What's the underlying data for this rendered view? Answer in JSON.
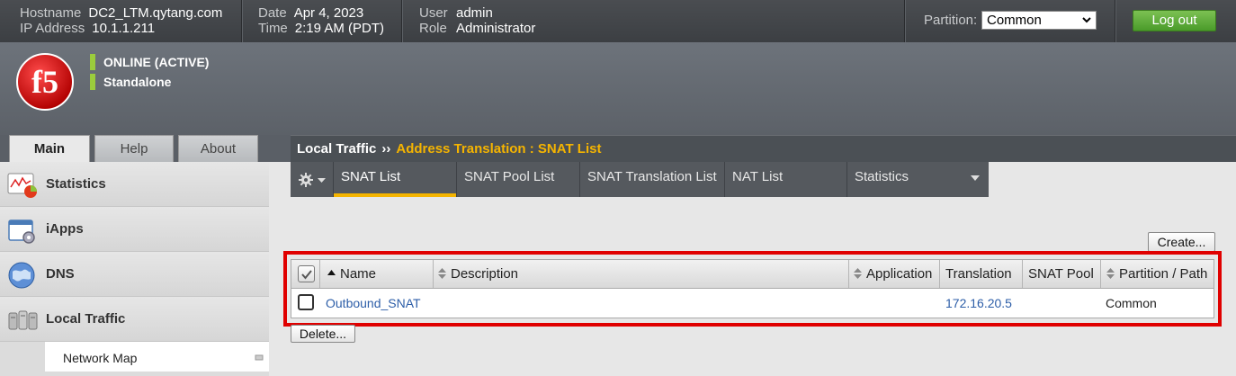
{
  "topbar": {
    "hostname_label": "Hostname",
    "hostname_value": "DC2_LTM.qytang.com",
    "ip_label": "IP Address",
    "ip_value": "10.1.1.211",
    "date_label": "Date",
    "date_value": "Apr 4, 2023",
    "time_label": "Time",
    "time_value": "2:19 AM (PDT)",
    "user_label": "User",
    "user_value": "admin",
    "role_label": "Role",
    "role_value": "Administrator",
    "partition_label": "Partition:",
    "partition_value": "Common",
    "logout_label": "Log out"
  },
  "banner": {
    "logo_text": "f5",
    "status_online": "ONLINE (ACTIVE)",
    "status_mode": "Standalone",
    "status_color": "#9bcc3c"
  },
  "left_tabs": [
    {
      "label": "Main",
      "active": true
    },
    {
      "label": "Help",
      "active": false
    },
    {
      "label": "About",
      "active": false
    }
  ],
  "left_nav": [
    {
      "label": "Statistics",
      "icon": "statistics-chart-icon"
    },
    {
      "label": "iApps",
      "icon": "iapps-window-gear-icon"
    },
    {
      "label": "DNS",
      "icon": "dns-globe-icon"
    },
    {
      "label": "Local Traffic",
      "icon": "local-traffic-servers-icon"
    }
  ],
  "left_subnav": {
    "network_map": "Network Map"
  },
  "breadcrumb": {
    "section": "Local Traffic",
    "separator": "››",
    "current": "Address Translation : SNAT List"
  },
  "sub_tabs": [
    {
      "label": "SNAT List",
      "active": true
    },
    {
      "label": "SNAT Pool List",
      "active": false
    },
    {
      "label": "SNAT Translation List",
      "active": false
    },
    {
      "label": "NAT List",
      "active": false
    },
    {
      "label": "Statistics",
      "active": false,
      "dropdown": true
    }
  ],
  "buttons": {
    "create": "Create...",
    "delete": "Delete..."
  },
  "table": {
    "columns": [
      "Name",
      "Description",
      "Application",
      "Translation",
      "SNAT Pool",
      "Partition / Path"
    ],
    "rows": [
      {
        "name": "Outbound_SNAT",
        "description": "",
        "application": "",
        "translation": "172.16.20.5",
        "snat_pool": "",
        "partition": "Common"
      }
    ]
  },
  "colors": {
    "accent": "#f5b400",
    "link": "#2d5ea8",
    "logout": "#5aa832",
    "highlight": "#e00000"
  }
}
